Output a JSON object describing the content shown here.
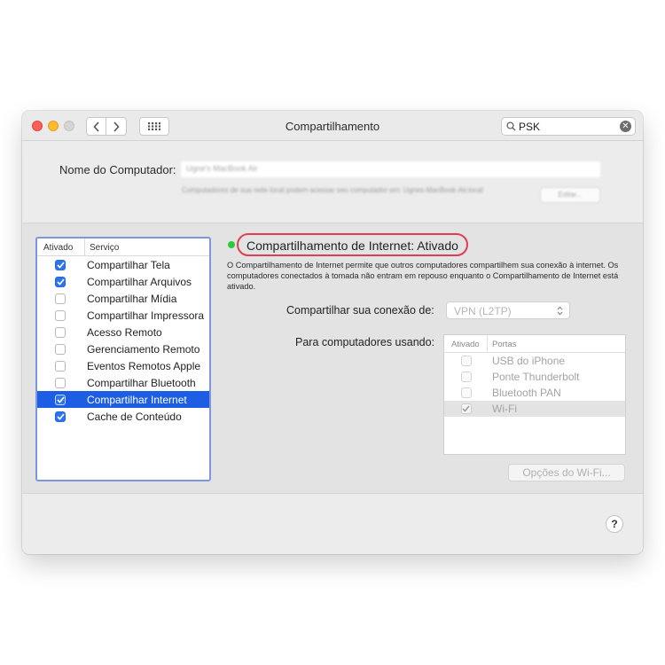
{
  "window": {
    "title": "Compartilhamento",
    "search": {
      "value": "PSK"
    }
  },
  "computer_name": {
    "label": "Nome do Computador:",
    "value": "Ugne's MacBook Air",
    "description": "Computadores de sua rede local podem acessar seu computador em: Ugnes-MacBook-Air.local",
    "edit_label": "Editar..."
  },
  "services": {
    "header_enabled": "Ativado",
    "header_service": "Serviço",
    "items": [
      {
        "label": "Compartilhar Tela",
        "checked": true,
        "selected": false
      },
      {
        "label": "Compartilhar Arquivos",
        "checked": true,
        "selected": false
      },
      {
        "label": "Compartilhar Mídia",
        "checked": false,
        "selected": false
      },
      {
        "label": "Compartilhar Impressora",
        "checked": false,
        "selected": false
      },
      {
        "label": "Acesso Remoto",
        "checked": false,
        "selected": false
      },
      {
        "label": "Gerenciamento Remoto",
        "checked": false,
        "selected": false
      },
      {
        "label": "Eventos Remotos Apple",
        "checked": false,
        "selected": false
      },
      {
        "label": "Compartilhar Bluetooth",
        "checked": false,
        "selected": false
      },
      {
        "label": "Compartilhar Internet",
        "checked": true,
        "selected": true
      },
      {
        "label": "Cache de Conteúdo",
        "checked": true,
        "selected": false
      }
    ]
  },
  "detail": {
    "status_title": "Compartilhamento de Internet: Ativado",
    "status_color": "#2cc938",
    "description": "O Compartilhamento de Internet permite que outros computadores compartilhem sua conexão à internet. Os computadores conectados à tomada não entram em repouso enquanto o Compartilhamento de Internet está ativado.",
    "share_label": "Compartilhar sua conexão de:",
    "share_value": "VPN (L2TP)",
    "using_label": "Para computadores usando:",
    "ports_header_enabled": "Ativado",
    "ports_header_ports": "Portas",
    "ports": [
      {
        "label": "USB do iPhone",
        "checked": false
      },
      {
        "label": "Ponte Thunderbolt",
        "checked": false
      },
      {
        "label": "Bluetooth PAN",
        "checked": false
      },
      {
        "label": "Wi-Fi",
        "checked": true
      }
    ],
    "wifi_options_label": "Opções do Wi-Fi..."
  },
  "help_label": "?"
}
